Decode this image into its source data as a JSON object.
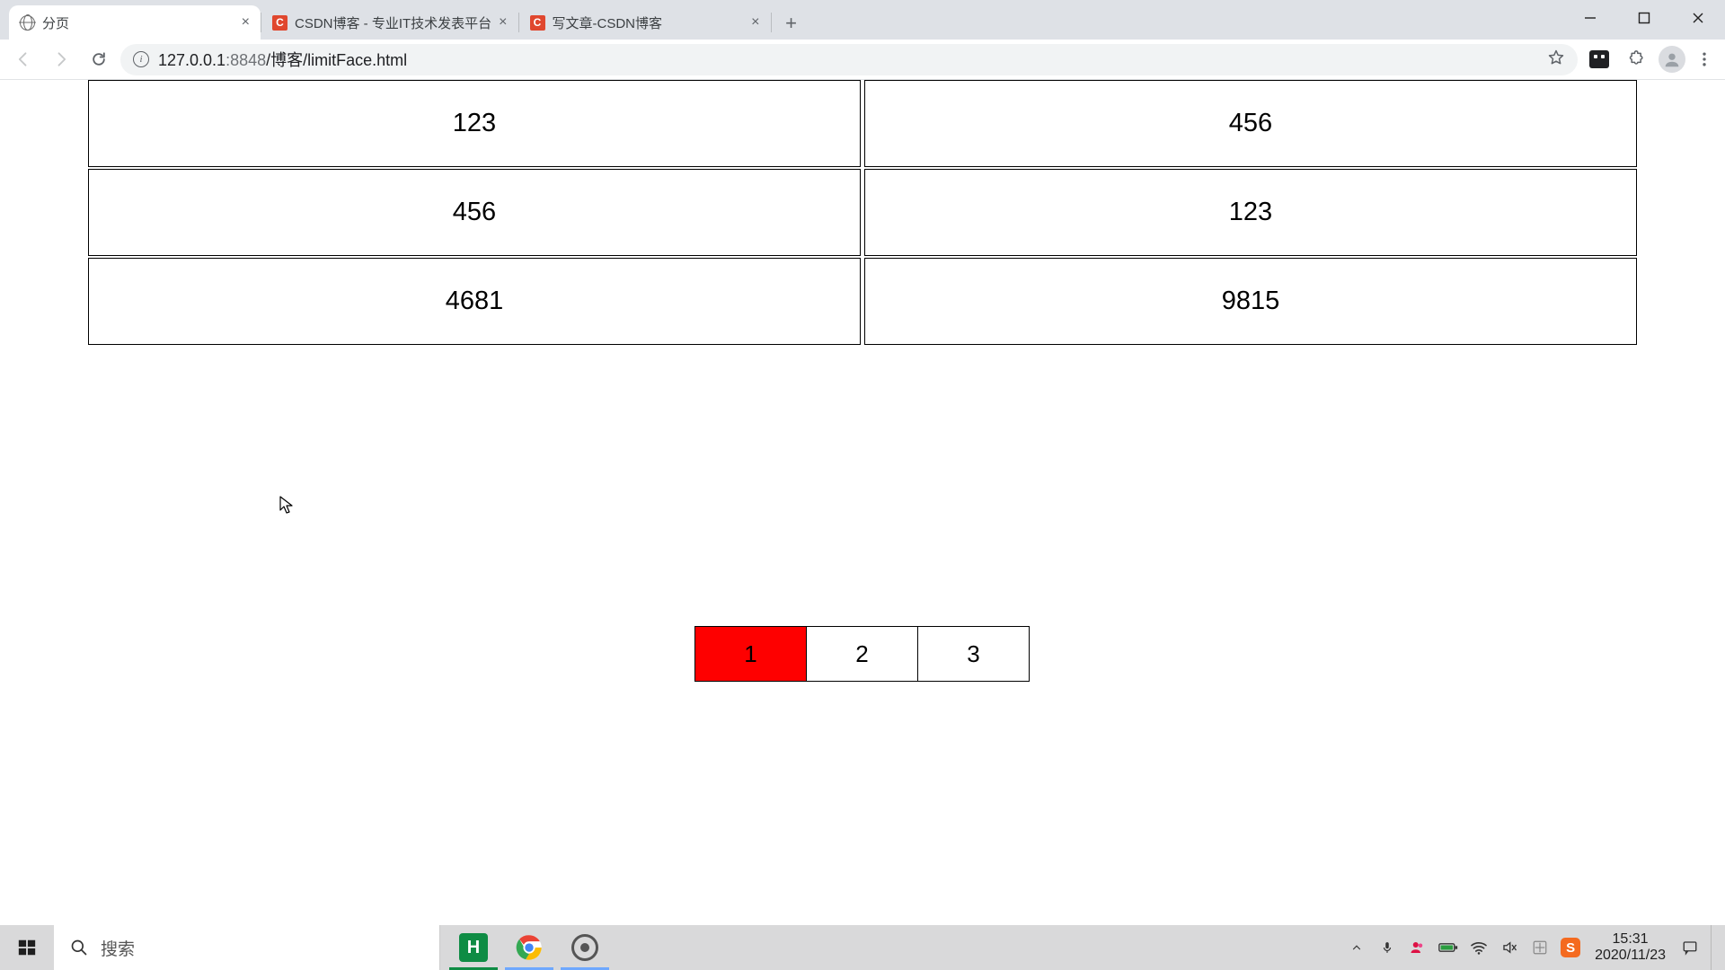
{
  "browser": {
    "tabs": [
      {
        "title": "分页",
        "favicon": "globe",
        "active": true
      },
      {
        "title": "CSDN博客 - 专业IT技术发表平台",
        "favicon": "c",
        "active": false
      },
      {
        "title": "写文章-CSDN博客",
        "favicon": "c",
        "active": false
      }
    ],
    "url_host": "127.0.0.1",
    "url_port": ":8848",
    "url_path": "/博客/limitFace.html"
  },
  "table_rows": [
    {
      "left": "123",
      "right": "456"
    },
    {
      "left": "456",
      "right": "123"
    },
    {
      "left": "4681",
      "right": "9815"
    }
  ],
  "pagination": {
    "pages": [
      "1",
      "2",
      "3"
    ],
    "active_index": 0
  },
  "taskbar": {
    "search_placeholder": "搜索",
    "time": "15:31",
    "date": "2020/11/23"
  }
}
